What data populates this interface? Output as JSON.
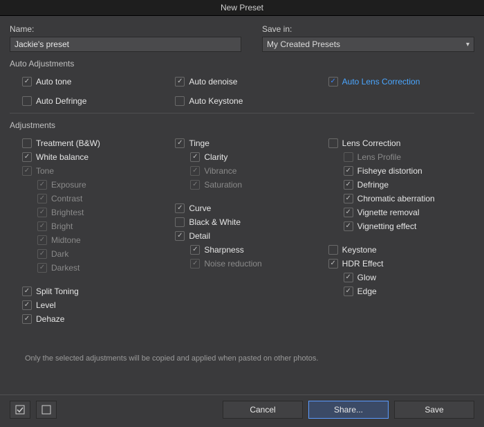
{
  "title": "New Preset",
  "fields": {
    "name_label": "Name:",
    "name_value": "Jackie's preset",
    "savein_label": "Save in:",
    "savein_value": "My Created Presets"
  },
  "sections": {
    "auto": "Auto Adjustments",
    "adjustments": "Adjustments"
  },
  "auto": {
    "tone": "Auto tone",
    "denoise": "Auto denoise",
    "lens": "Auto Lens Correction",
    "defringe": "Auto Defringe",
    "keystone": "Auto Keystone"
  },
  "adj": {
    "treatment": "Treatment (B&W)",
    "wb": "White balance",
    "tone": "Tone",
    "exposure": "Exposure",
    "contrast": "Contrast",
    "brightest": "Brightest",
    "bright": "Bright",
    "midtone": "Midtone",
    "dark": "Dark",
    "darkest": "Darkest",
    "split": "Split Toning",
    "level": "Level",
    "dehaze": "Dehaze",
    "tinge": "Tinge",
    "clarity": "Clarity",
    "vibrance": "Vibrance",
    "saturation": "Saturation",
    "curve": "Curve",
    "bw": "Black & White",
    "detail": "Detail",
    "sharp": "Sharpness",
    "noise": "Noise reduction",
    "lenscorr": "Lens Correction",
    "lensprofile": "Lens Profile",
    "fisheye": "Fisheye distortion",
    "defringe": "Defringe",
    "ca": "Chromatic aberration",
    "vigrem": "Vignette removal",
    "vigeff": "Vignetting effect",
    "keystone": "Keystone",
    "hdr": "HDR Effect",
    "glow": "Glow",
    "edge": "Edge"
  },
  "note": "Only the selected adjustments will be copied and applied when pasted on other photos.",
  "buttons": {
    "cancel": "Cancel",
    "share": "Share...",
    "save": "Save"
  }
}
